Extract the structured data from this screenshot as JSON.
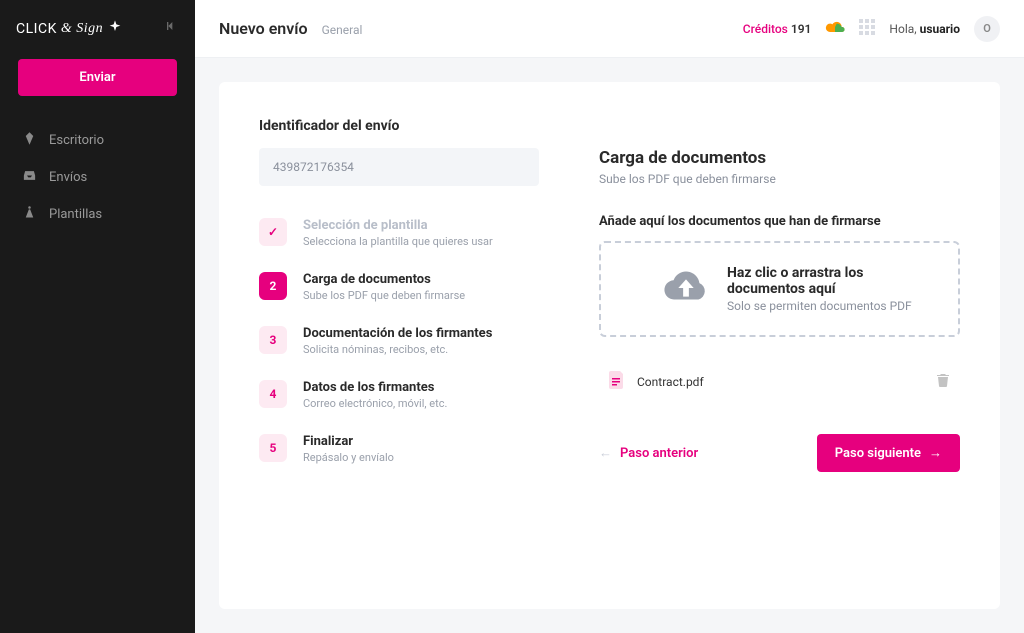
{
  "brand": {
    "name_a": "CLICK",
    "amp": "&",
    "name_b": "Sign"
  },
  "sidebar": {
    "send_label": "Enviar",
    "items": [
      {
        "label": "Escritorio"
      },
      {
        "label": "Envíos"
      },
      {
        "label": "Plantillas"
      }
    ]
  },
  "topbar": {
    "title": "Nuevo envío",
    "subtitle": "General",
    "credits_label": "Créditos",
    "credits_value": "191",
    "greeting_prefix": "Hola,",
    "greeting_user": "usuario",
    "avatar_initial": "O"
  },
  "identifier": {
    "label": "Identificador del envío",
    "value": "439872176354"
  },
  "steps": [
    {
      "badge": "✓",
      "title": "Selección de plantilla",
      "desc": "Selecciona la plantilla que quieres usar",
      "state": "done"
    },
    {
      "badge": "2",
      "title": "Carga de documentos",
      "desc": "Sube los PDF que deben firmarse",
      "state": "active"
    },
    {
      "badge": "3",
      "title": "Documentación de los firmantes",
      "desc": "Solicita nóminas, recibos, etc.",
      "state": "pending"
    },
    {
      "badge": "4",
      "title": "Datos de los firmantes",
      "desc": "Correo electrónico, móvil, etc.",
      "state": "pending"
    },
    {
      "badge": "5",
      "title": "Finalizar",
      "desc": "Repásalo y envíalo",
      "state": "pending"
    }
  ],
  "right": {
    "heading": "Carga de documentos",
    "sub": "Sube los PDF que deben firmarse",
    "add_label": "Añade aquí los documentos que han de firmarse",
    "dropzone_title": "Haz clic o arrastra los documentos aquí",
    "dropzone_sub": "Solo se permiten documentos PDF"
  },
  "files": [
    {
      "name": "Contract.pdf"
    }
  ],
  "nav": {
    "prev": "Paso anterior",
    "next": "Paso siguiente"
  },
  "colors": {
    "accent": "#e6007e",
    "sidebar_bg": "#1a1a1a"
  }
}
